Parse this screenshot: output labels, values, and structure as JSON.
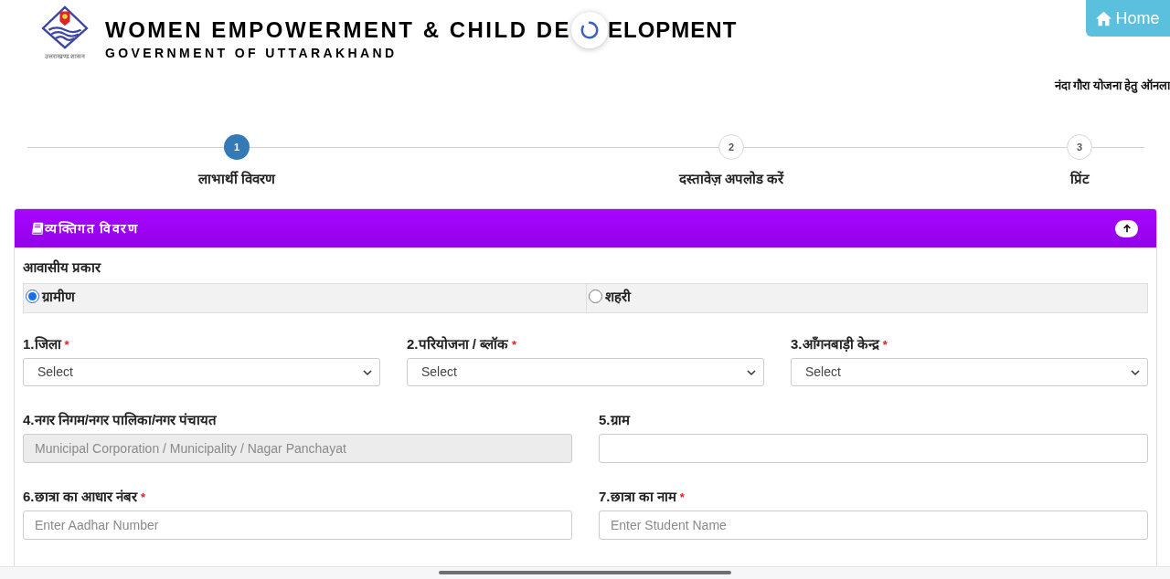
{
  "loading": true,
  "header": {
    "logo_caption": "उत्तराखण्ड शासन",
    "title_parts": [
      "WOMEN EMPOWERMENT & CHILD DE",
      "ELOPMENT"
    ],
    "subtitle": "GOVERNMENT OF UTTARAKHAND",
    "home_button": {
      "label": "Home"
    }
  },
  "notice": "नंदा गौरा योजना हेतु ऑनला",
  "steps": [
    {
      "number": "1",
      "label": "लाभार्थी विवरण",
      "selected": true
    },
    {
      "number": "2",
      "label": "दस्तावेज़ अपलोड करें",
      "selected": false
    },
    {
      "number": "3",
      "label": "प्रिंट",
      "selected": false
    }
  ],
  "section": {
    "title": "व्यक्तिगत विवरण",
    "expanded": true,
    "residence_type": {
      "label": "आवासीय प्रकार",
      "options": [
        {
          "label": "ग्रामीण",
          "selected": true
        },
        {
          "label": "शहरी",
          "selected": false
        }
      ]
    },
    "field_rows": [
      [
        {
          "kind": "select",
          "label": "1.जिला",
          "required_mark": "*",
          "value": "Select"
        },
        {
          "kind": "select",
          "label": "2.परियोजना / ब्लॉक",
          "required_mark": "*",
          "value": "Select"
        },
        {
          "kind": "select",
          "label": "3.आँगनबाड़ी केन्द्र",
          "required_mark": "*",
          "value": "Select"
        }
      ],
      [
        {
          "kind": "input",
          "label": "4.नगर निगम/नगर पालिका/नगर पंचायत",
          "placeholder": "Municipal Corporation / Municipality / Nagar Panchayat",
          "disabled": true
        },
        {
          "kind": "input",
          "label": "5.ग्राम",
          "disabled": false
        }
      ],
      [
        {
          "kind": "input",
          "label": "6.छात्रा का आधार नंबर",
          "required_mark": "*",
          "placeholder": "Enter Aadhar Number",
          "disabled": false
        },
        {
          "kind": "input",
          "label": "7.छात्रा का नाम",
          "required_mark": "*",
          "placeholder": "Enter Student Name",
          "disabled": false
        }
      ]
    ]
  }
}
